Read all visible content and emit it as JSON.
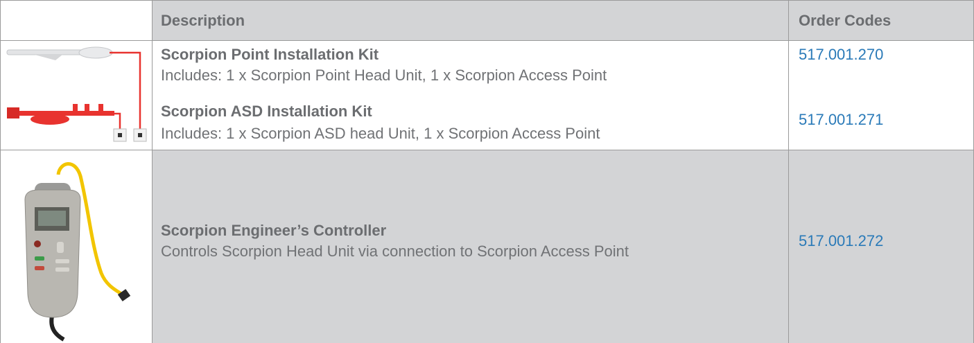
{
  "header": {
    "description": "Description",
    "order_codes": "Order Codes"
  },
  "rows": [
    {
      "name": "Scorpion Point Installation Kit",
      "description": "Includes: 1 x Scorpion Point Head Unit, 1 x Scorpion Access Point",
      "code": "517.001.270"
    },
    {
      "name": "Scorpion ASD Installation Kit",
      "description": "Includes: 1 x Scorpion ASD head Unit, 1 x Scorpion Access Point",
      "code": "517.001.271"
    },
    {
      "name": "Scorpion Engineer’s Controller",
      "description": "Controls Scorpion Head Unit via connection to Scorpion Access Point",
      "code": "517.001.272"
    }
  ],
  "colors": {
    "header_bg": "#d3d4d6",
    "row3_bg": "#d3d4d6",
    "heading_text": "#6b6d70",
    "code_text": "#2a7ab8",
    "kit_red": "#e8332f",
    "cable_yellow": "#f2c500"
  },
  "icons": [
    "installation-kit-image",
    "engineer-controller-image"
  ]
}
